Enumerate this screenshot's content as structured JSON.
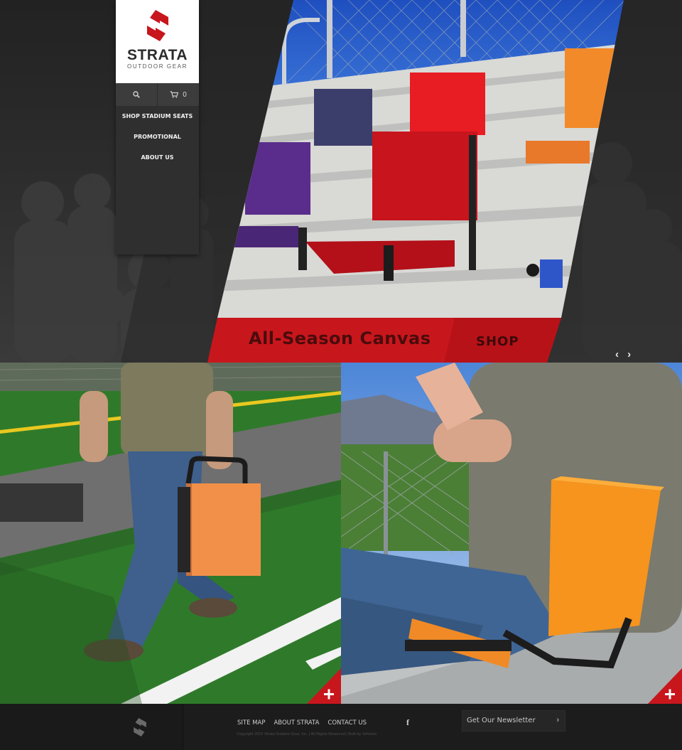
{
  "brand": {
    "name": "STRATA",
    "tagline": "OUTDOOR GEAR",
    "accent": "#c8161d",
    "logo_icon": "strata-s-icon"
  },
  "toolbar": {
    "search_icon": "search-icon",
    "cart_icon": "cart-icon",
    "cart_count": "0"
  },
  "nav": {
    "items": [
      {
        "label": "SHOP STADIUM SEATS"
      },
      {
        "label": "PROMOTIONAL"
      },
      {
        "label": "ABOUT US"
      }
    ]
  },
  "hero": {
    "caption": "All-Season Canvas",
    "shop_label": "SHOP",
    "prev_icon": "‹",
    "next_icon": "›",
    "banner_color": "#c8161d"
  },
  "panels": {
    "plus_icon": "plus-icon",
    "plus_color": "#c8161d"
  },
  "footer": {
    "links": [
      {
        "label": "SITE MAP"
      },
      {
        "label": "ABOUT STRATA"
      },
      {
        "label": "CONTACT US"
      }
    ],
    "copyright": "Copyright 2015 Strata Outdoor Gear, Inc.   |   All Rights Reserved   |   Built by Vehicles",
    "social_icon": "f",
    "newsletter_label": "Get Our Newsletter",
    "newsletter_arrow": "›"
  }
}
